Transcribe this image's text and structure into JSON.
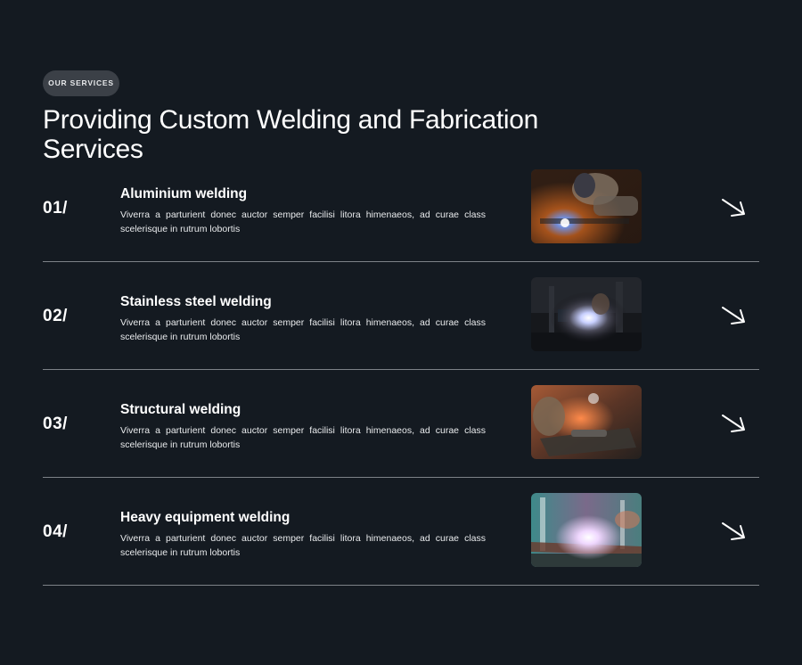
{
  "section": {
    "badge": "OUR SERVICES",
    "title": "Providing Custom Welding and Fabrication Services"
  },
  "services": [
    {
      "number": "01/",
      "name": "Aluminium welding",
      "description": "Viverra a parturient donec auctor semper facilisi litora himenaeos, ad curae class scelerisque in rutrum lobortis",
      "image": "welder-aluminium-photo",
      "arrow_icon": "arrow-right-icon"
    },
    {
      "number": "02/",
      "name": "Stainless steel welding",
      "description": "Viverra a parturient donec auctor semper facilisi litora himenaeos, ad curae class scelerisque in rutrum lobortis",
      "image": "welder-stainless-photo",
      "arrow_icon": "arrow-right-icon"
    },
    {
      "number": "03/",
      "name": "Structural welding",
      "description": "Viverra a parturient donec auctor semper facilisi litora himenaeos, ad curae class scelerisque in rutrum lobortis",
      "image": "welder-structural-photo",
      "arrow_icon": "arrow-right-icon"
    },
    {
      "number": "04/",
      "name": "Heavy equipment welding",
      "description": "Viverra a parturient donec auctor semper facilisi litora himenaeos, ad curae class scelerisque in rutrum lobortis",
      "image": "welder-heavy-equipment-photo",
      "arrow_icon": "arrow-right-icon"
    }
  ],
  "colors": {
    "background": "#141a21",
    "badge_bg": "#3b4047",
    "divider": "#7d8288",
    "text": "#ffffff"
  }
}
